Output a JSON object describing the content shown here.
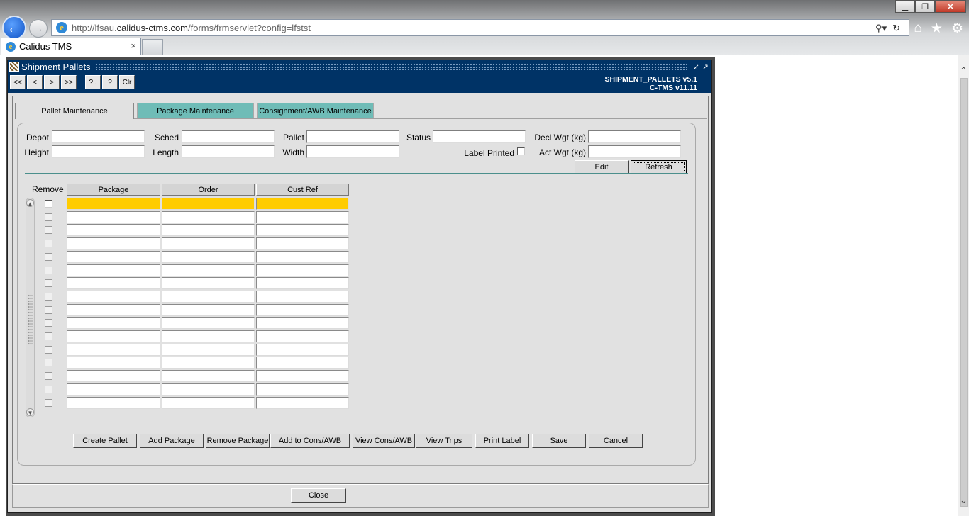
{
  "browser": {
    "url_prefix": "http://lfsau.",
    "url_domain": "calidus-ctms.com",
    "url_suffix": "/forms/frmservlet?config=lfstst",
    "tab_title": "Calidus TMS",
    "tab_close": "×",
    "window_controls": {
      "minimize": "▁",
      "maximize": "❐",
      "close": "✕"
    },
    "icons": {
      "back": "back-arrow-icon",
      "forward": "forward-arrow-icon",
      "search": "search-icon",
      "refresh": "refresh-icon",
      "home": "home-icon",
      "favorites": "star-icon",
      "tools": "gear-icon"
    }
  },
  "forms_window": {
    "title": "Shipment Pallets",
    "form_name": "SHIPMENT_PALLETS v5.1",
    "app_version": "C-TMS v11.11",
    "nav_buttons": [
      "<<",
      "<",
      ">",
      ">>",
      "?..",
      "?",
      "Clr"
    ]
  },
  "tabs": [
    {
      "label": "Pallet Maintenance",
      "active": true
    },
    {
      "label": "Package Maintenance",
      "active": false
    },
    {
      "label": "Consignment/AWB Maintenance",
      "active": false
    }
  ],
  "fields": {
    "depot": {
      "label": "Depot",
      "value": ""
    },
    "sched": {
      "label": "Sched",
      "value": ""
    },
    "pallet": {
      "label": "Pallet",
      "value": ""
    },
    "status": {
      "label": "Status",
      "value": ""
    },
    "decl_wgt": {
      "label": "Decl Wgt (kg)",
      "value": ""
    },
    "height": {
      "label": "Height",
      "value": ""
    },
    "length": {
      "label": "Length",
      "value": ""
    },
    "width": {
      "label": "Width",
      "value": ""
    },
    "label_printed": {
      "label": "Label Printed",
      "checked": false
    },
    "act_wgt": {
      "label": "Act Wgt (kg)",
      "value": ""
    }
  },
  "action_buttons": {
    "edit": "Edit",
    "refresh": "Refresh"
  },
  "grid": {
    "remove_label": "Remove",
    "columns": [
      "Package",
      "Order",
      "Cust Ref"
    ],
    "row_count": 16,
    "current_row": 1
  },
  "bottom_buttons": [
    "Create Pallet",
    "Add Package",
    "Remove Package",
    "Add to Cons/AWB",
    "View Cons/AWB",
    "View Trips",
    "Print Label",
    "Save",
    "Cancel"
  ],
  "close_button": "Close",
  "colors": {
    "title_bar": "#003366",
    "inactive_tab": "#6fbcb7",
    "current_row": "#ffcc00",
    "canvas": "#e1e1e1"
  }
}
